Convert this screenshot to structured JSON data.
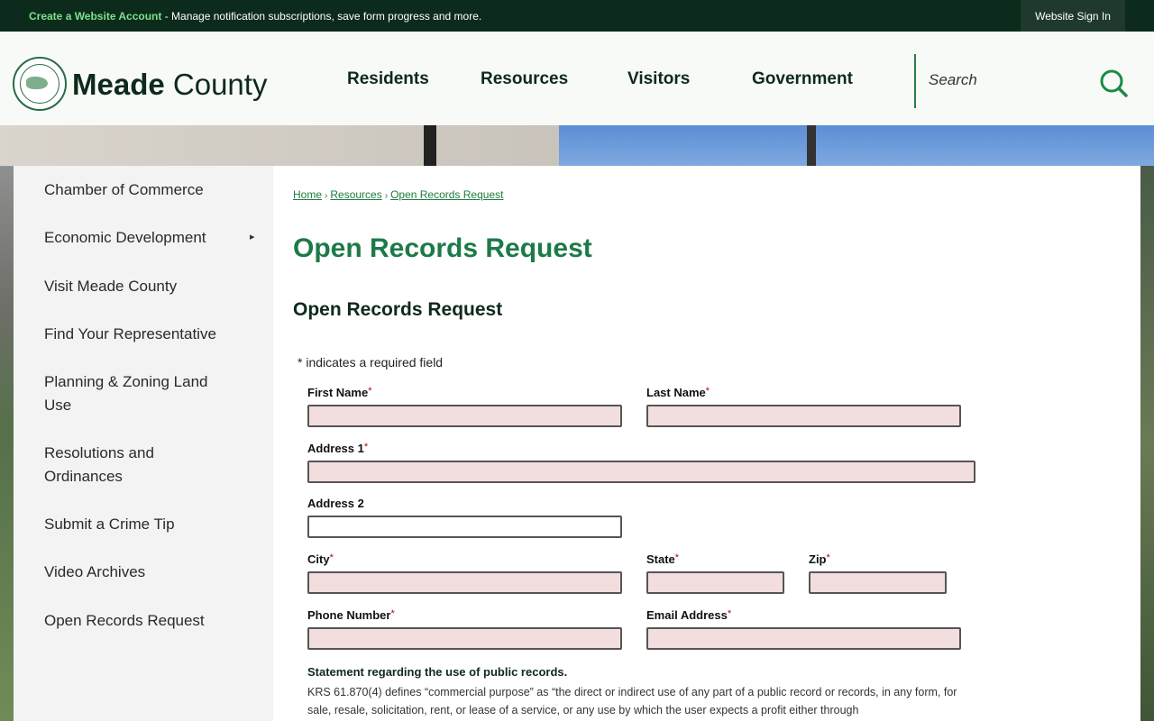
{
  "topbar": {
    "promo_link": "Create a Website Account",
    "promo_text": " - Manage notification subscriptions, save form progress and more.",
    "signin_label": "Website Sign In"
  },
  "header": {
    "logo_bold": "Meade",
    "logo_regular": " County",
    "nav": [
      "Residents",
      "Resources",
      "Visitors",
      "Government"
    ],
    "search_placeholder": "Search"
  },
  "sidebar": {
    "items": [
      "Chamber of Commerce",
      "Economic Development",
      "Visit Meade County",
      "Find Your Representative",
      "Planning & Zoning Land Use",
      "Resolutions and Ordinances",
      "Submit a Crime Tip",
      "Video Archives",
      "Open Records Request"
    ],
    "arrow": "▸"
  },
  "breadcrumb": {
    "items": [
      "Home",
      "Resources",
      "Open Records Request"
    ],
    "separator": "›"
  },
  "page": {
    "title": "Open Records Request",
    "form_title": "Open Records Request",
    "required_note": "* indicates a required field"
  },
  "form": {
    "required_marker": "*",
    "first_name": "First Name",
    "last_name": "Last Name",
    "address1": "Address 1",
    "address2": "Address 2",
    "city": "City",
    "state": "State",
    "zip": "Zip",
    "phone": "Phone Number",
    "email": "Email Address"
  },
  "statement": {
    "title": "Statement regarding the use of public records.",
    "body": "KRS 61.870(4) defines “commercial purpose” as “the direct or indirect use of any part of a public record or records, in any form, for sale, resale, solicitation, rent, or lease of a service, or any use by which the user expects a profit either through"
  },
  "colors": {
    "topbar": "#0d2b1c",
    "accent_green": "#1d7a48",
    "required_field_bg": "#f2dede"
  }
}
